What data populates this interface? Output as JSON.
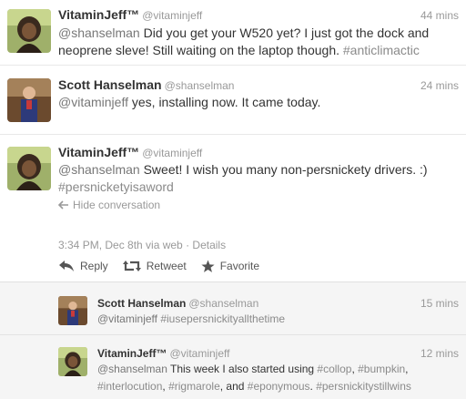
{
  "tweets": [
    {
      "name": "VitaminJeff™",
      "handle": "@vitaminjeff",
      "time": "44 mins",
      "text": [
        {
          "t": "@shanselman",
          "k": "mention"
        },
        {
          "t": " Did you get your W520 yet? I just got the dock and neoprene sleve! Still waiting on the laptop though. ",
          "k": "plain"
        },
        {
          "t": "#anticlimactic",
          "k": "hashtag"
        }
      ]
    },
    {
      "name": "Scott Hanselman",
      "handle": "@shanselman",
      "time": "24 mins",
      "text": [
        {
          "t": "@vitaminjeff",
          "k": "mention"
        },
        {
          "t": " yes, installing now. It came today.",
          "k": "plain"
        }
      ]
    },
    {
      "name": "VitaminJeff™",
      "handle": "@vitaminjeff",
      "time": "",
      "text": [
        {
          "t": "@shanselman",
          "k": "mention"
        },
        {
          "t": " Sweet! I wish you many non-persnickety drivers. :) ",
          "k": "plain"
        },
        {
          "t": "#persnicketyisaword",
          "k": "hashtag"
        }
      ],
      "hide_conversation": "Hide conversation",
      "meta": "3:34 PM, Dec 8th via web · Details",
      "actions": {
        "reply": "Reply",
        "retweet": "Retweet",
        "favorite": "Favorite"
      }
    }
  ],
  "replies": [
    {
      "name": "Scott Hanselman",
      "handle": "@shanselman",
      "time": "15 mins",
      "text": [
        {
          "t": "@vitaminjeff",
          "k": "mention"
        },
        {
          "t": " ",
          "k": "plain"
        },
        {
          "t": "#iusepersnickityallthetime",
          "k": "hashtag"
        }
      ]
    },
    {
      "name": "VitaminJeff™",
      "handle": "@vitaminjeff",
      "time": "12 mins",
      "text": [
        {
          "t": "@shanselman",
          "k": "mention"
        },
        {
          "t": " This week I also started using ",
          "k": "plain"
        },
        {
          "t": "#collop",
          "k": "hashtag"
        },
        {
          "t": ", ",
          "k": "plain"
        },
        {
          "t": "#bumpkin",
          "k": "hashtag"
        },
        {
          "t": ", ",
          "k": "plain"
        },
        {
          "t": "#interlocution",
          "k": "hashtag"
        },
        {
          "t": ", ",
          "k": "plain"
        },
        {
          "t": "#rigmarole",
          "k": "hashtag"
        },
        {
          "t": ", and ",
          "k": "plain"
        },
        {
          "t": "#eponymous",
          "k": "hashtag"
        },
        {
          "t": ". ",
          "k": "plain"
        },
        {
          "t": "#persnickitystillwins",
          "k": "hashtag"
        }
      ]
    }
  ],
  "icons": {
    "hide": "arrow-left-icon",
    "reply": "reply-arrow-icon",
    "retweet": "retweet-icon",
    "favorite": "star-icon"
  },
  "colors": {
    "link_gray": "#999999",
    "text": "#333333",
    "reply_bg": "#f5f5f5"
  }
}
